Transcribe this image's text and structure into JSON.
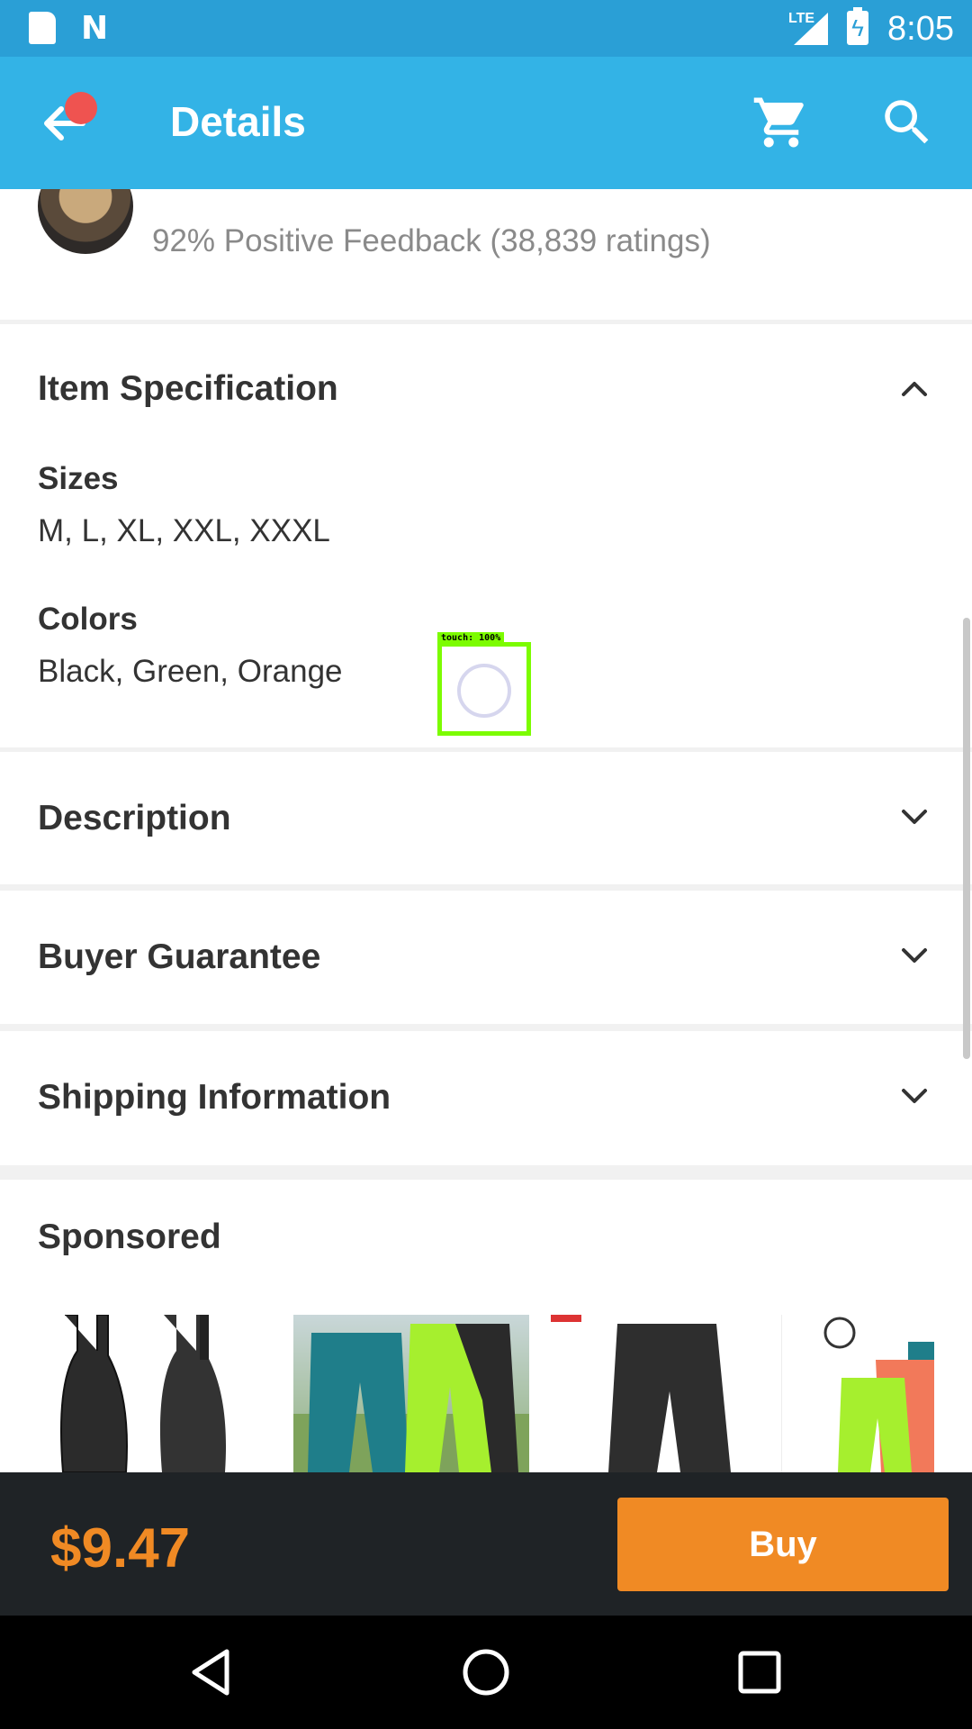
{
  "status_bar": {
    "network": "LTE",
    "time": "8:05"
  },
  "app_bar": {
    "title": "Details",
    "icons": [
      "back-arrow-icon",
      "cart-icon",
      "search-icon"
    ]
  },
  "seller": {
    "feedback": "92% Positive Feedback (38,839 ratings)"
  },
  "item_specification": {
    "title": "Item Specification",
    "expanded": true,
    "specs": [
      {
        "label": "Sizes",
        "value": "M, L, XL, XXL, XXXL"
      },
      {
        "label": "Colors",
        "value": "Black, Green, Orange"
      }
    ]
  },
  "sections": {
    "description": "Description",
    "buyer_guarantee": "Buyer Guarantee",
    "shipping_information": "Shipping Information"
  },
  "sponsored": {
    "title": "Sponsored",
    "products": [
      "black bib shorts",
      "teal and green cycling pants",
      "black cycling shorts",
      "green and orange cycling shorts"
    ]
  },
  "touch_overlay": {
    "label": "touch: 100%"
  },
  "purchase": {
    "price": "$9.47",
    "buy_label": "Buy"
  },
  "colors": {
    "status_bar": "#2a9fd6",
    "app_bar": "#33b3e6",
    "accent_orange": "#f08a24",
    "buy_bar": "#1f2326"
  }
}
